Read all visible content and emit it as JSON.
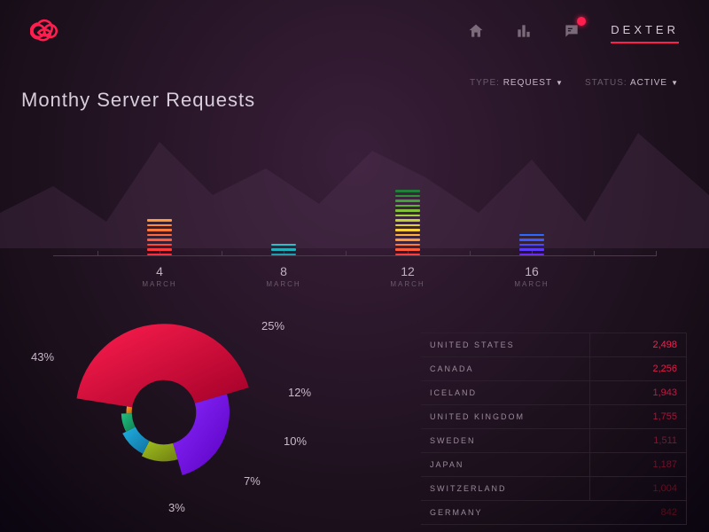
{
  "header": {
    "user": "DEXTER",
    "icons": {
      "home": "home-icon",
      "analytics": "chart-icon",
      "chat": "chat-icon"
    }
  },
  "filters": {
    "type_label": "TYPE:",
    "type_value": "REQUEST",
    "status_label": "STATUS:",
    "status_value": "ACTIVE"
  },
  "title": "Monthy Server Requests",
  "chart_data": {
    "type": "bar",
    "categories": [
      "4",
      "8",
      "12",
      "16"
    ],
    "month_labels": [
      "MARCH",
      "MARCH",
      "MARCH",
      "MARCH"
    ],
    "values": [
      8,
      3,
      14,
      5
    ],
    "series_colors": [
      [
        "#ff2a3a",
        "#ff3a3a",
        "#ff4a3a",
        "#ff5a3a",
        "#ff6a3a",
        "#ff7a3a",
        "#ff8a3a",
        "#ff9a3a"
      ],
      [
        "#1aa0b0",
        "#22b0bb",
        "#2ac0c6"
      ],
      [
        "#ff3a3a",
        "#ff5a3a",
        "#ff7a3a",
        "#ff9a3a",
        "#ffb03a",
        "#ffd03a",
        "#e0d03a",
        "#c0d03a",
        "#a0d03a",
        "#80c03a",
        "#60b03a",
        "#40a03a",
        "#30903a",
        "#20803a"
      ],
      [
        "#6a2aff",
        "#5a3aff",
        "#4a4aff",
        "#3a5aff",
        "#2a6aff"
      ]
    ],
    "donut": {
      "type": "pie",
      "segments": [
        {
          "label": "43%",
          "value": 43,
          "color1": "#ff1e4e",
          "color2": "#a00028"
        },
        {
          "label": "25%",
          "value": 25,
          "color1": "#8a2aff",
          "color2": "#5a00c0"
        },
        {
          "label": "12%",
          "value": 12,
          "color1": "#a0c020",
          "color2": "#708010"
        },
        {
          "label": "10%",
          "value": 10,
          "color1": "#20b0e0",
          "color2": "#1070a0"
        },
        {
          "label": "7%",
          "value": 7,
          "color1": "#20c080",
          "color2": "#108050"
        },
        {
          "label": "3%",
          "value": 3,
          "color1": "#ffa020",
          "color2": "#c06010"
        }
      ]
    }
  },
  "table": {
    "rows": [
      {
        "country": "UNITED STATES",
        "value": "2,498",
        "color": "#ff1e4e"
      },
      {
        "country": "CANADA",
        "value": "2,256",
        "color": "#e01e48"
      },
      {
        "country": "ICELAND",
        "value": "1,943",
        "color": "#c01a40"
      },
      {
        "country": "UNITED KINGDOM",
        "value": "1,755",
        "color": "#a01838"
      },
      {
        "country": "SWEDEN",
        "value": "1,511",
        "color": "#801430"
      },
      {
        "country": "JAPAN",
        "value": "1,187",
        "color": "#701228"
      },
      {
        "country": "SWITZERLAND",
        "value": "1,004",
        "color": "#601020"
      },
      {
        "country": "GERMANY",
        "value": "842",
        "color": "#500e1a"
      }
    ]
  }
}
